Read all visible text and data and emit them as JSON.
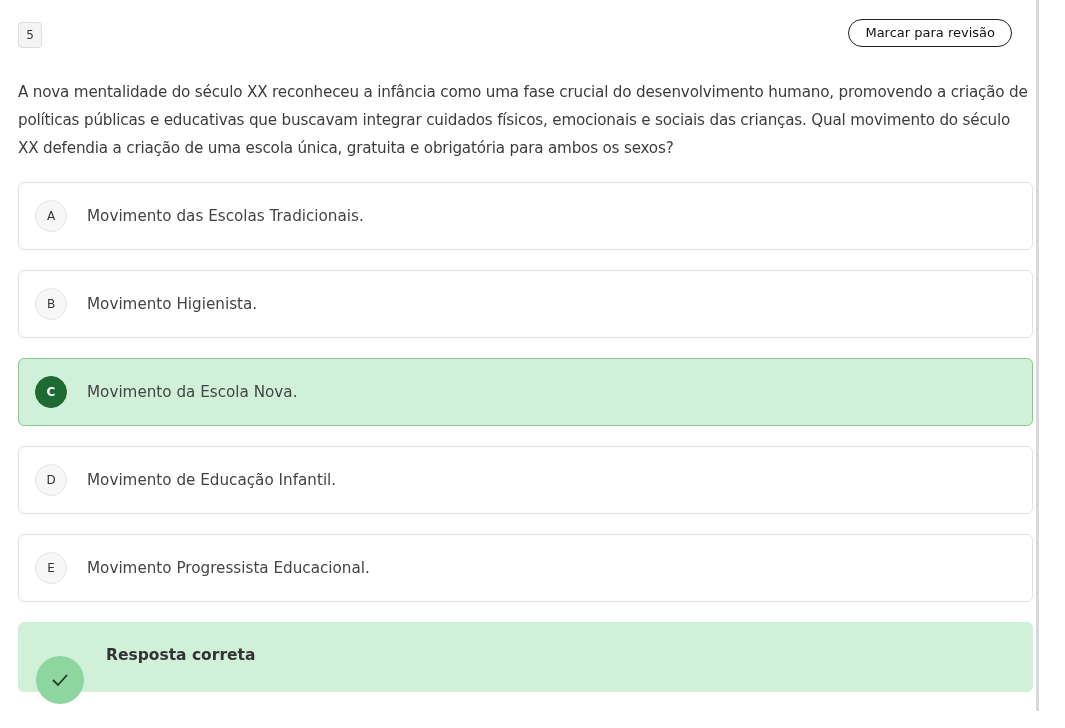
{
  "question": {
    "number": "5",
    "review_button": "Marcar para revisão",
    "text": "A nova mentalidade do século XX reconheceu a infância como uma fase crucial do desenvolvimento humano, promovendo a criação de políticas públicas e educativas que buscavam integrar cuidados físicos, emocionais e sociais das crianças. Qual movimento do século XX defendia a criação de uma escola única, gratuita e obrigatória para ambos os sexos?"
  },
  "options": [
    {
      "letter": "A",
      "text": "Movimento das Escolas Tradicionais.",
      "selected": false
    },
    {
      "letter": "B",
      "text": "Movimento Higienista.",
      "selected": false
    },
    {
      "letter": "C",
      "text": "Movimento da Escola Nova.",
      "selected": true
    },
    {
      "letter": "D",
      "text": "Movimento de Educação Infantil.",
      "selected": false
    },
    {
      "letter": "E",
      "text": "Movimento Progressista Educacional.",
      "selected": false
    }
  ],
  "feedback": {
    "kind": "correct",
    "title": "Resposta correta"
  }
}
